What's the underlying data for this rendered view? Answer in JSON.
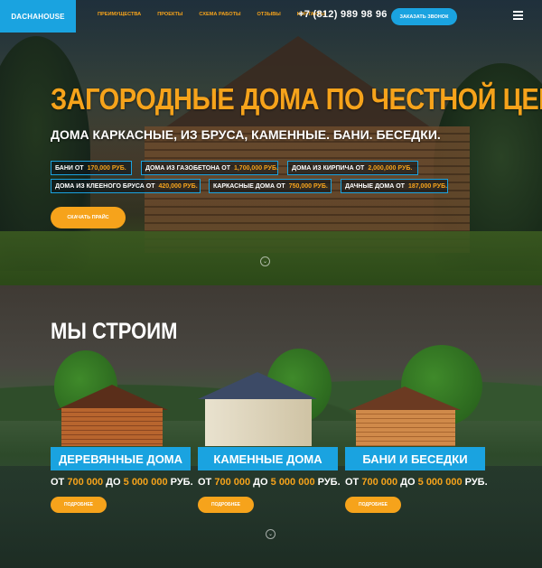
{
  "header": {
    "logo": "DACHAHOUSE",
    "nav": [
      "ПРЕИМУЩЕСТВА",
      "ПРОЕКТЫ",
      "СХЕМА РАБОТЫ",
      "ОТЗЫВЫ",
      "КОНТАКТЫ"
    ],
    "phone": "+7 (812) 989 98 96",
    "call_button": "ЗАКАЗАТЬ ЗВОНОК",
    "menu_icon": "hamburger-icon"
  },
  "hero": {
    "title": "ЗАГОРОДНЫЕ ДОМА ПО ЧЕСТНОЙ ЦЕНЕ.",
    "subtitle": "ДОМА КАРКАСНЫЕ, ИЗ БРУСА, КАМЕННЫЕ. БАНИ. БЕСЕДКИ.",
    "tags": [
      {
        "label": "БАНИ ОТ",
        "price": "170,000 РУБ."
      },
      {
        "label": "ДОМА ИЗ ГАЗОБЕТОНА ОТ",
        "price": "1,700,000 РУБ."
      },
      {
        "label": "ДОМА ИЗ КИРПИЧА ОТ",
        "price": "2,000,000 РУБ."
      },
      {
        "label": "ДОМА ИЗ КЛЕЕНОГО БРУСА ОТ",
        "price": "420,000 РУБ."
      },
      {
        "label": "КАРКАСНЫЕ ДОМА ОТ",
        "price": "750,000 РУБ."
      },
      {
        "label": "ДАЧНЫЕ ДОМА ОТ",
        "price": "187,000 РУБ."
      }
    ],
    "cta": "СКАЧАТЬ ПРАЙС",
    "scroll_icon": "chevron-down-icon"
  },
  "build": {
    "title": "МЫ СТРОИМ",
    "cards": [
      {
        "label": "ДЕРЕВЯННЫЕ ДОМА",
        "from_word": "ОТ",
        "from": "700 000",
        "to_word": "ДО",
        "to": "5 000 000",
        "unit": "РУБ.",
        "button": "ПОДРОБНЕЕ"
      },
      {
        "label": "КАМЕННЫЕ ДОМА",
        "from_word": "ОТ",
        "from": "700 000",
        "to_word": "ДО",
        "to": "5 000 000",
        "unit": "РУБ.",
        "button": "ПОДРОБНЕЕ"
      },
      {
        "label": "БАНИ И БЕСЕДКИ",
        "from_word": "ОТ",
        "from": "700 000",
        "to_word": "ДО",
        "to": "5 000 000",
        "unit": "РУБ.",
        "button": "ПОДРОБНЕЕ"
      }
    ],
    "scroll_icon": "chevron-down-icon"
  },
  "colors": {
    "accent_blue": "#1aa3e0",
    "accent_orange": "#f6a31b"
  }
}
